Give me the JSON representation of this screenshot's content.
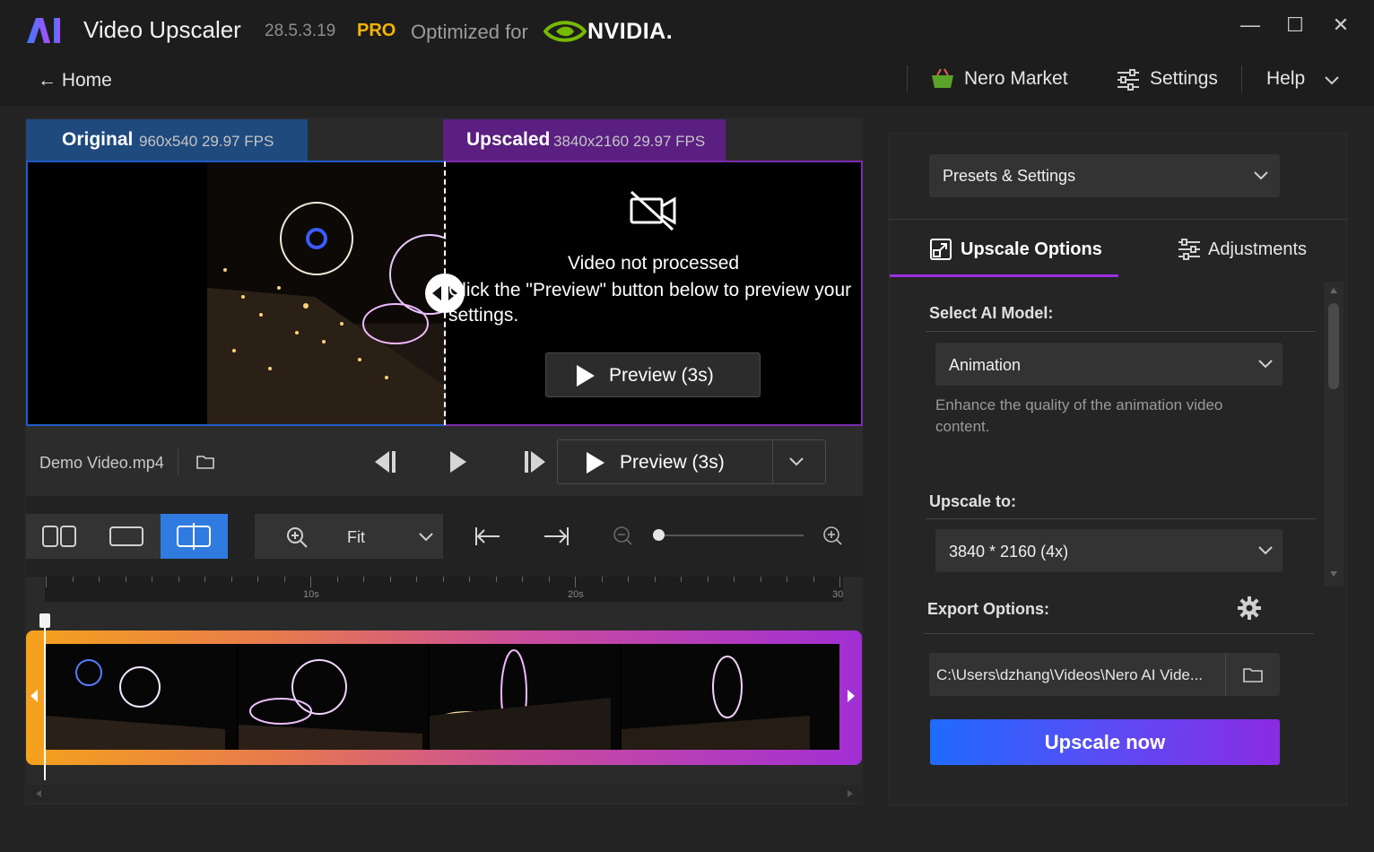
{
  "titlebar": {
    "app_title": "Video Upscaler",
    "version": "28.5.3.19",
    "pro": "PRO",
    "optimized": "Optimized for",
    "nvidia": "NVIDIA.",
    "logo_text": "AI"
  },
  "nav": {
    "home": "← Home",
    "market": "Nero Market",
    "settings": "Settings",
    "help": "Help"
  },
  "viewer": {
    "original_label": "Original",
    "original_meta": "960x540 29.97 FPS",
    "upscaled_label": "Upscaled",
    "upscaled_meta": "3840x2160 29.97 FPS",
    "not_processed_title": "Video not processed",
    "not_processed_desc": "Click the \"Preview\" button below to preview your settings.",
    "preview_button": "Preview (3s)"
  },
  "controls": {
    "filename": "Demo Video.mp4",
    "preview_button": "Preview (3s)"
  },
  "toolbar": {
    "zoom_value": "Fit",
    "zoom_slider": 0.0
  },
  "timeline": {
    "ticks": [
      "10s",
      "20s",
      "30"
    ]
  },
  "panel": {
    "presets": "Presets & Settings",
    "tab_upscale": "Upscale Options",
    "tab_adjust": "Adjustments",
    "ai_model_title": "Select AI Model:",
    "ai_model_value": "Animation",
    "ai_model_desc": "Enhance the quality of the animation video content.",
    "upscale_to_title": "Upscale to:",
    "upscale_to_value": "3840 * 2160 (4x)",
    "export_title": "Export Options:",
    "export_path": "C:\\Users\\dzhang\\Videos\\Nero AI Vide...",
    "upscale_now": "Upscale now"
  },
  "colors": {
    "accent_blue": "#2f7be0",
    "accent_purple": "#9b2fe0",
    "pro_gold": "#f4b400",
    "nvidia_green": "#76b900"
  }
}
